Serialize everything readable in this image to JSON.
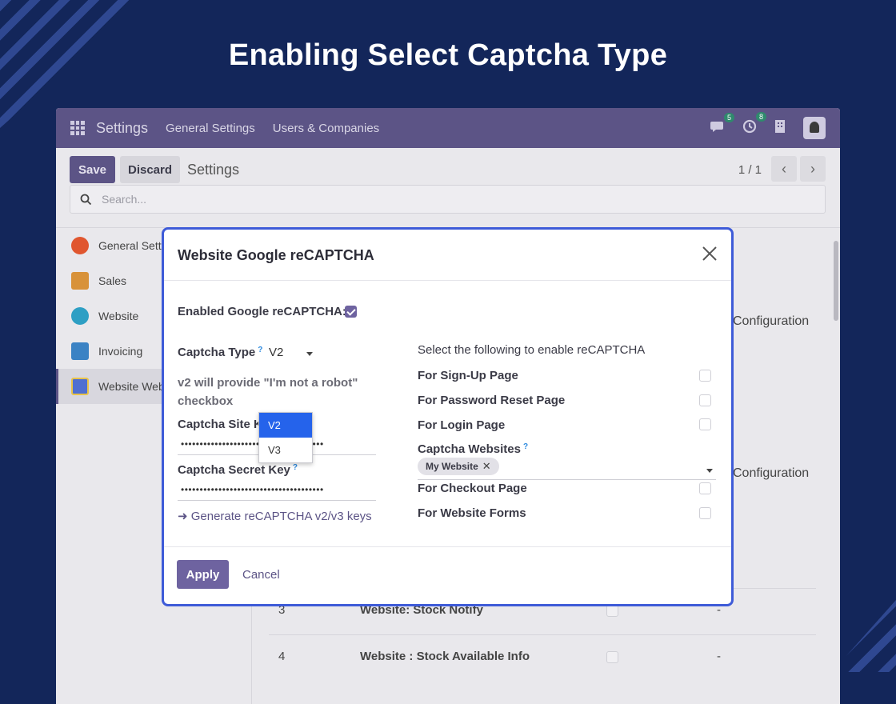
{
  "page": {
    "headline": "Enabling Select Captcha Type"
  },
  "navbar": {
    "app_name": "Settings",
    "links": [
      "General Settings",
      "Users & Companies"
    ],
    "chat_badge": "5",
    "activity_badge": "8"
  },
  "control": {
    "save_label": "Save",
    "discard_label": "Discard",
    "breadcrumb": "Settings",
    "pager": "1 / 1",
    "search_placeholder": "Search..."
  },
  "sidebar": {
    "items": [
      {
        "label": "General Settings",
        "color": "#e0562f"
      },
      {
        "label": "Sales",
        "color": "#d8923a"
      },
      {
        "label": "Website",
        "color": "#2e9fc4"
      },
      {
        "label": "Invoicing",
        "color": "#3b82c4"
      },
      {
        "label": "Website Website Captcha",
        "color": "#4f6fd0"
      }
    ]
  },
  "content": {
    "config_label_1": "Configuration",
    "config_label_2": "Configuration",
    "rows": [
      {
        "num": "3",
        "name": "Website: Stock Notify",
        "value": "-"
      },
      {
        "num": "4",
        "name": "Website : Stock Available Info",
        "value": "-"
      }
    ]
  },
  "modal": {
    "title": "Website Google reCAPTCHA",
    "enabled_label": "Enabled Google reCAPTCHA:",
    "captcha_type_label": "Captcha Type",
    "help_mark": "?",
    "captcha_type_value": "V2",
    "captcha_type_options": [
      "V2",
      "V3"
    ],
    "v2_description": "v2 will provide \"I'm not a robot\" checkbox",
    "site_key_label": "Captcha Site Key",
    "site_key_value": "••••••••••••••••••••••••••••••••••••••",
    "secret_key_label": "Captcha Secret Key",
    "secret_key_value": "••••••••••••••••••••••••••••••••••••••",
    "generate_link": "➜ Generate reCAPTCHA v2/v3 keys",
    "select_heading": "Select the following to enable reCAPTCHA",
    "signup_label": "For Sign-Up Page",
    "password_reset_label": "For Password Reset Page",
    "login_label": "For Login Page",
    "websites_label": "Captcha Websites",
    "website_tag": "My Website",
    "tag_remove": "✕",
    "checkout_label": "For Checkout Page",
    "forms_label": "For Website Forms",
    "apply_label": "Apply",
    "cancel_label": "Cancel"
  }
}
